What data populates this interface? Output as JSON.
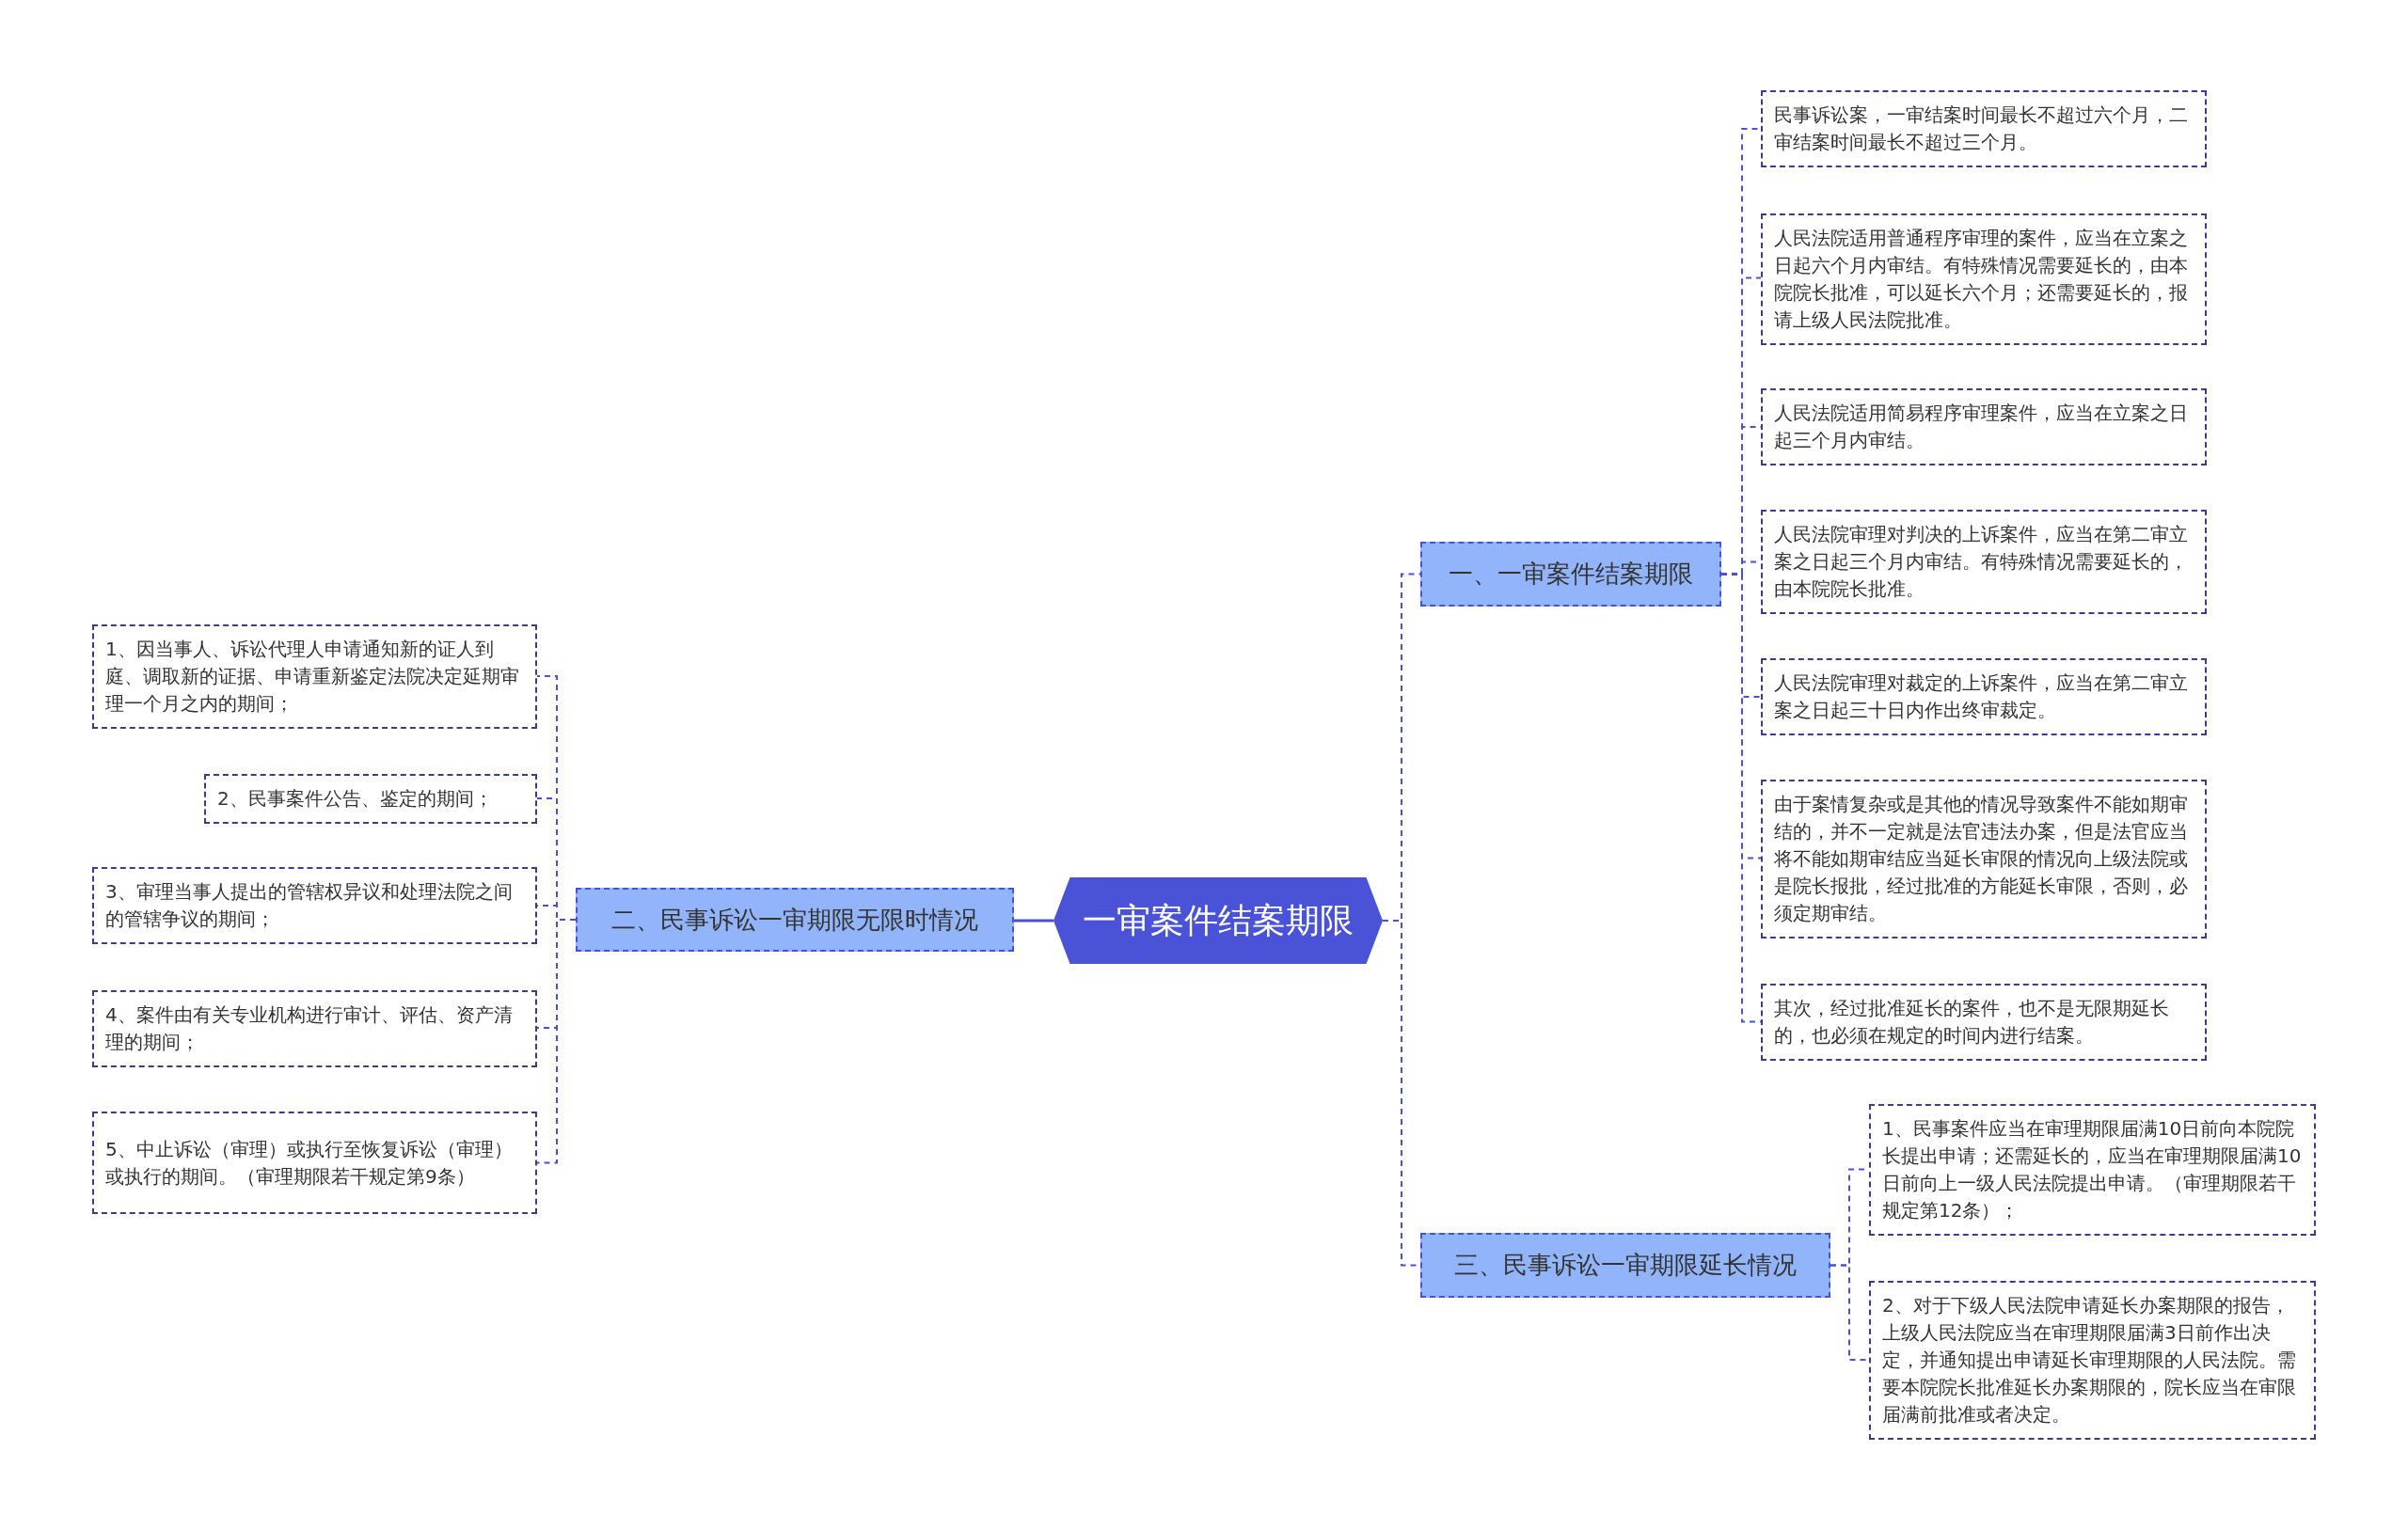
{
  "root": {
    "title": "一审案件结案期限"
  },
  "branches": [
    {
      "title": "一、一审案件结案期限",
      "children": [
        {
          "text": "民事诉讼案，一审结案时间最长不超过六个月，二审结案时间最长不超过三个月。"
        },
        {
          "text": "人民法院适用普通程序审理的案件，应当在立案之日起六个月内审结。有特殊情况需要延长的，由本院院长批准，可以延长六个月；还需要延长的，报请上级人民法院批准。"
        },
        {
          "text": "人民法院适用简易程序审理案件，应当在立案之日起三个月内审结。"
        },
        {
          "text": "人民法院审理对判决的上诉案件，应当在第二审立案之日起三个月内审结。有特殊情况需要延长的，由本院院长批准。"
        },
        {
          "text": "人民法院审理对裁定的上诉案件，应当在第二审立案之日起三十日内作出终审裁定。"
        },
        {
          "text": "由于案情复杂或是其他的情况导致案件不能如期审结的，并不一定就是法官违法办案，但是法官应当将不能如期审结应当延长审限的情况向上级法院或是院长报批，经过批准的方能延长审限，否则，必须定期审结。"
        },
        {
          "text": "其次，经过批准延长的案件，也不是无限期延长的，也必须在规定的时间内进行结案。"
        }
      ]
    },
    {
      "title": "二、民事诉讼一审期限无限时情况",
      "children": [
        {
          "text": "1、因当事人、诉讼代理人申请通知新的证人到庭、调取新的证据、申请重新鉴定法院决定延期审理一个月之内的期间；"
        },
        {
          "text": "2、民事案件公告、鉴定的期间；"
        },
        {
          "text": "3、审理当事人提出的管辖权异议和处理法院之间的管辖争议的期间；"
        },
        {
          "text": "4、案件由有关专业机构进行审计、评估、资产清理的期间；"
        },
        {
          "text": "5、中止诉讼（审理）或执行至恢复诉讼（审理）或执行的期间。（审理期限若干规定第9条）"
        }
      ]
    },
    {
      "title": "三、民事诉讼一审期限延长情况",
      "children": [
        {
          "text": "1、民事案件应当在审理期限届满10日前向本院院长提出申请；还需延长的，应当在审理期限届满10日前向上一级人民法院提出申请。（审理期限若干规定第12条）；"
        },
        {
          "text": "2、对于下级人民法院申请延长办案期限的报告，上级人民法院应当在审理期限届满3日前作出决定，并通知提出申请延长审理期限的人民法院。需要本院院长批准延长办案期限的，院长应当在审限届满前批准或者决定。"
        }
      ]
    }
  ]
}
